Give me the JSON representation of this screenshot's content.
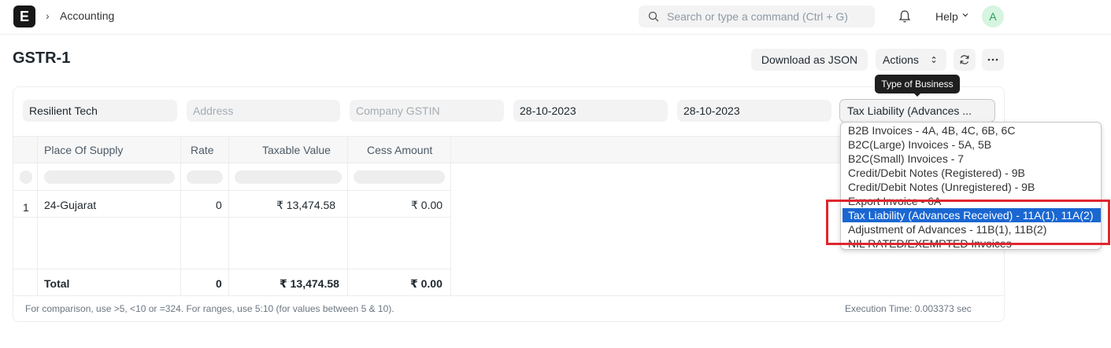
{
  "topbar": {
    "logo_letter": "E",
    "breadcrumb_sep": "›",
    "breadcrumb": "Accounting",
    "search_placeholder": "Search or type a command (Ctrl + G)",
    "help_label": "Help",
    "avatar_letter": "A"
  },
  "page": {
    "title": "GSTR-1",
    "download_json_label": "Download as JSON",
    "actions_label": "Actions"
  },
  "filters": {
    "company": "Resilient Tech",
    "address_placeholder": "Address",
    "gstin_placeholder": "Company GSTIN",
    "from_date": "28-10-2023",
    "to_date": "28-10-2023",
    "type_of_business": "Tax Liability (Advances ...",
    "tooltip": "Type of Business"
  },
  "table": {
    "columns": [
      "Place Of Supply",
      "Rate",
      "Taxable Value",
      "Cess Amount"
    ],
    "rows": [
      {
        "index": "1",
        "place": "24-Gujarat",
        "rate": "0",
        "taxable": "₹ 13,474.58",
        "cess": "₹ 0.00"
      }
    ],
    "total": {
      "label": "Total",
      "rate": "0",
      "taxable": "₹ 13,474.58",
      "cess": "₹ 0.00"
    }
  },
  "footer": {
    "hint": "For comparison, use >5, <10 or =324. For ranges, use 5:10 (for values between 5 & 10).",
    "execution_time": "Execution Time: 0.003373 sec"
  },
  "dropdown": {
    "options": [
      "B2B Invoices - 4A, 4B, 4C, 6B, 6C",
      "B2C(Large) Invoices - 5A, 5B",
      "B2C(Small) Invoices - 7",
      "Credit/Debit Notes (Registered) - 9B",
      "Credit/Debit Notes (Unregistered) - 9B",
      "Export Invoice - 6A",
      "Tax Liability (Advances Received) - 11A(1), 11A(2)",
      "Adjustment of Advances - 11B(1), 11B(2)",
      "NIL RATED/EXEMPTED Invoices"
    ],
    "selected_index": 6
  },
  "colors": {
    "selected_option": "#1a67d2",
    "highlight_box": "#e0262f"
  }
}
